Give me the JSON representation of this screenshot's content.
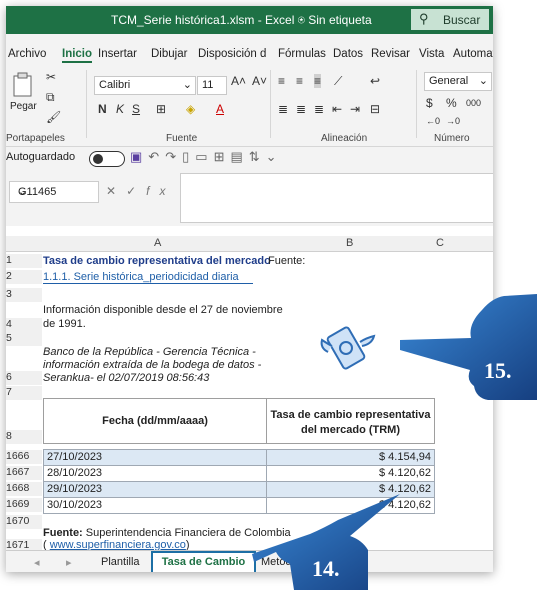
{
  "window": {
    "title": "TCM_Serie histórica1.xlsm  -  Excel",
    "sensitivity": "Sin etiqueta",
    "search_label": "Buscar"
  },
  "menu": [
    "Archivo",
    "Inicio",
    "Insertar",
    "Dibujar",
    "Disposición d",
    "Fórmulas",
    "Datos",
    "Revisar",
    "Vista",
    "Automatizar"
  ],
  "ribbon": {
    "paste_label": "Pegar",
    "font_name": "Calibri",
    "font_size": "11",
    "number_format": "General",
    "groups": [
      "Portapapeles",
      "Fuente",
      "Alineación",
      "Número"
    ]
  },
  "qat": {
    "autosave_label": "Autoguardado"
  },
  "formula_bar": {
    "name_box": "G11465",
    "fx": "fx"
  },
  "columns": [
    "A",
    "B",
    "C"
  ],
  "rows": [
    {
      "num": "1",
      "a": "Tasa de cambio representativa del mercado",
      "b": "Fuente:"
    },
    {
      "num": "2",
      "a": "1.1.1. Serie histórica_periodicidad diaria"
    },
    {
      "num": "3"
    },
    {
      "num": "4",
      "a1": "Información disponible desde el 27 de noviembre",
      "a2": "de 1991."
    },
    {
      "num": "5"
    },
    {
      "num": "6",
      "a1": " Banco de la República - Gerencia Técnica -",
      "a2": "información extraída de la bodega de datos -",
      "a3": "Serankua- el 02/07/2019 08:56:43"
    },
    {
      "num": "7"
    },
    {
      "num": "8",
      "a": "Fecha (dd/mm/aaaa)",
      "b1": "Tasa de cambio representativa",
      "b2": "del mercado (TRM)"
    }
  ],
  "data_rows": [
    {
      "num": "1666",
      "date": "27/10/2023",
      "value": "$ 4.154,94",
      "shaded": true
    },
    {
      "num": "1667",
      "date": "28/10/2023",
      "value": "$ 4.120,62",
      "shaded": false
    },
    {
      "num": "1668",
      "date": "29/10/2023",
      "value": "$ 4.120,62",
      "shaded": true
    },
    {
      "num": "1669",
      "date": "30/10/2023",
      "value": "$ 4.120,62",
      "shaded": false
    }
  ],
  "footer_rows": [
    {
      "num": "1670"
    },
    {
      "num": "1671",
      "source_label": "Fuente:",
      "source_text": " Superintendencia Financiera de Colombia",
      "link_prefix": "( ",
      "link": "www.superfinanciera.gov.co",
      "link_suffix": ")"
    }
  ],
  "sheet_tabs": [
    "Plantilla",
    "Tasa de Cambio",
    "Metodo"
  ],
  "callouts": {
    "badge_15": "15.",
    "badge_14": "14."
  },
  "colors": {
    "excel_green": "#1e7145",
    "callout_blue": "#1f5fa8",
    "row_shade": "#dce8f4"
  }
}
